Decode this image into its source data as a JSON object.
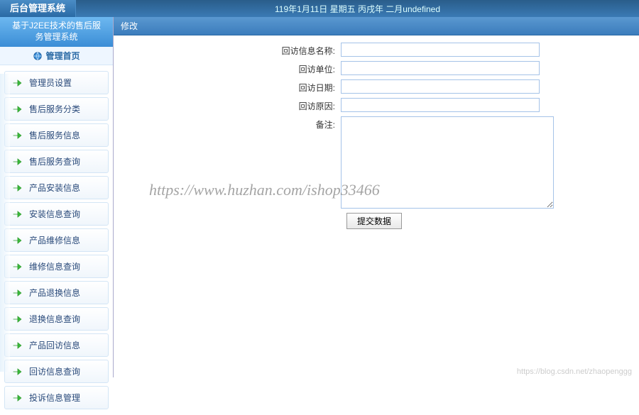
{
  "header": {
    "system_title": "后台管理系统",
    "date_line": "119年1月11日 星期五 丙戌年 二月undefined"
  },
  "sidebar": {
    "subtitle_line1": "基于J2EE技术的售后服",
    "subtitle_line2": "务管理系统",
    "home_label": "管理首页",
    "items": [
      {
        "label": "管理员设置"
      },
      {
        "label": "售后服务分类"
      },
      {
        "label": "售后服务信息"
      },
      {
        "label": "售后服务查询"
      },
      {
        "label": "产品安装信息"
      },
      {
        "label": "安装信息查询"
      },
      {
        "label": "产品维修信息"
      },
      {
        "label": "维修信息查询"
      },
      {
        "label": "产品退换信息"
      },
      {
        "label": "退换信息查询"
      },
      {
        "label": "产品回访信息"
      },
      {
        "label": "回访信息查询"
      },
      {
        "label": "投诉信息管理"
      }
    ]
  },
  "main": {
    "panel_title": "修改",
    "form": {
      "visit_name_label": "回访信息名称:",
      "visit_name_value": "",
      "visit_unit_label": "回访单位:",
      "visit_unit_value": "",
      "visit_date_label": "回访日期:",
      "visit_date_value": "",
      "visit_reason_label": "回访原因:",
      "visit_reason_value": "",
      "remark_label": "备注:",
      "remark_value": "",
      "submit_label": "提交数据"
    }
  },
  "watermark": {
    "center": "https://www.huzhan.com/ishop33466",
    "footer": "https://blog.csdn.net/zhaopenggg"
  },
  "icons": {
    "arrow": "arrow-right-green",
    "globe": "globe"
  }
}
